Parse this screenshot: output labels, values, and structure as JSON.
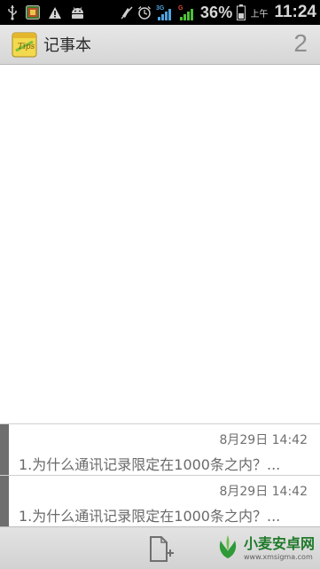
{
  "status_bar": {
    "battery_text": "36%",
    "ampm": "上午",
    "time": "11:24",
    "icons": [
      "usb-icon",
      "app-notification-icon",
      "warning-icon",
      "android-icon",
      "mute-icon",
      "alarm-icon",
      "signal-3g-icon",
      "signal-g-icon",
      "battery-icon"
    ]
  },
  "titlebar": {
    "title": "记事本",
    "count": "2",
    "icon": "notepad-icon"
  },
  "notes": [
    {
      "date": "8月29日 14:42",
      "text": "1.为什么通讯记录限定在1000条之内？..."
    },
    {
      "date": "8月29日 14:42",
      "text": "1.为什么通讯记录限定在1000条之内？..."
    }
  ],
  "bottom_bar": {
    "new_note_icon": "new-note-icon"
  },
  "watermark": {
    "title": "小麦安卓网",
    "url": "www.xmsigma.com"
  },
  "colors": {
    "statusbar_bg": "#000000",
    "titlebar_bg": "#dedede",
    "note_accent": "#6e6e6e",
    "watermark_green": "#1f7a2a"
  }
}
